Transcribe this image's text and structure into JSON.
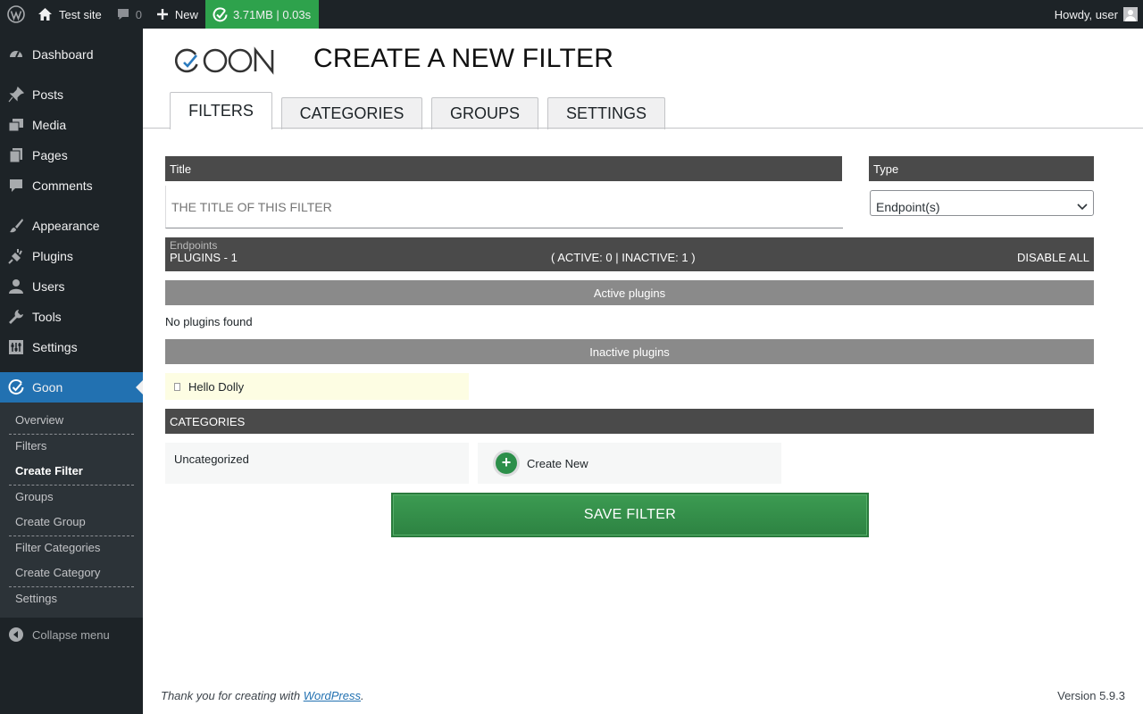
{
  "adminbar": {
    "site_name": "Test site",
    "comments_count": "0",
    "new_label": "New",
    "perf_label": "3.71MB | 0.03s",
    "howdy": "Howdy, user"
  },
  "sidebar": {
    "items": [
      {
        "label": "Dashboard",
        "icon": "dashboard-icon"
      },
      {
        "label": "Posts",
        "icon": "pin-icon"
      },
      {
        "label": "Media",
        "icon": "media-icon"
      },
      {
        "label": "Pages",
        "icon": "pages-icon"
      },
      {
        "label": "Comments",
        "icon": "comment-icon"
      },
      {
        "label": "Appearance",
        "icon": "paintbrush-icon"
      },
      {
        "label": "Plugins",
        "icon": "plugin-icon"
      },
      {
        "label": "Users",
        "icon": "user-icon"
      },
      {
        "label": "Tools",
        "icon": "wrench-icon"
      },
      {
        "label": "Settings",
        "icon": "settings-icon"
      },
      {
        "label": "Goon",
        "icon": "goon-check-icon"
      }
    ],
    "submenu": [
      "Overview",
      "Filters",
      "Create Filter",
      "Groups",
      "Create Group",
      "Filter Categories",
      "Create Category",
      "Settings"
    ],
    "collapse_label": "Collapse menu"
  },
  "page": {
    "title": "CREATE A NEW FILTER",
    "tabs": [
      "FILTERS",
      "CATEGORIES",
      "GROUPS",
      "SETTINGS"
    ],
    "title_label": "Title",
    "title_placeholder": "THE TITLE OF THIS FILTER",
    "type_label": "Type",
    "type_value": "Endpoint(s)",
    "plugins_ghost": "Endpoints",
    "plugins_count": "PLUGINS - 1",
    "plugins_status": "( ACTIVE: 0 | INACTIVE: 1 )",
    "disable_all": "DISABLE ALL",
    "active_header": "Active plugins",
    "no_plugins": "No plugins found",
    "inactive_header": "Inactive plugins",
    "inactive_plugin": "Hello Dolly",
    "categories_header": "CATEGORIES",
    "category_item": "Uncategorized",
    "create_new": "Create New",
    "save_label": "SAVE FILTER"
  },
  "footer": {
    "thanks_prefix": "Thank you for creating with ",
    "wordpress_link": "WordPress",
    "thanks_suffix": ".",
    "version": "Version 5.9.3"
  },
  "colors": {
    "adminbar_bg": "#1d2327",
    "accent": "#2271b1",
    "perf_green": "#2ea24c",
    "save_green": "#2d8342"
  }
}
